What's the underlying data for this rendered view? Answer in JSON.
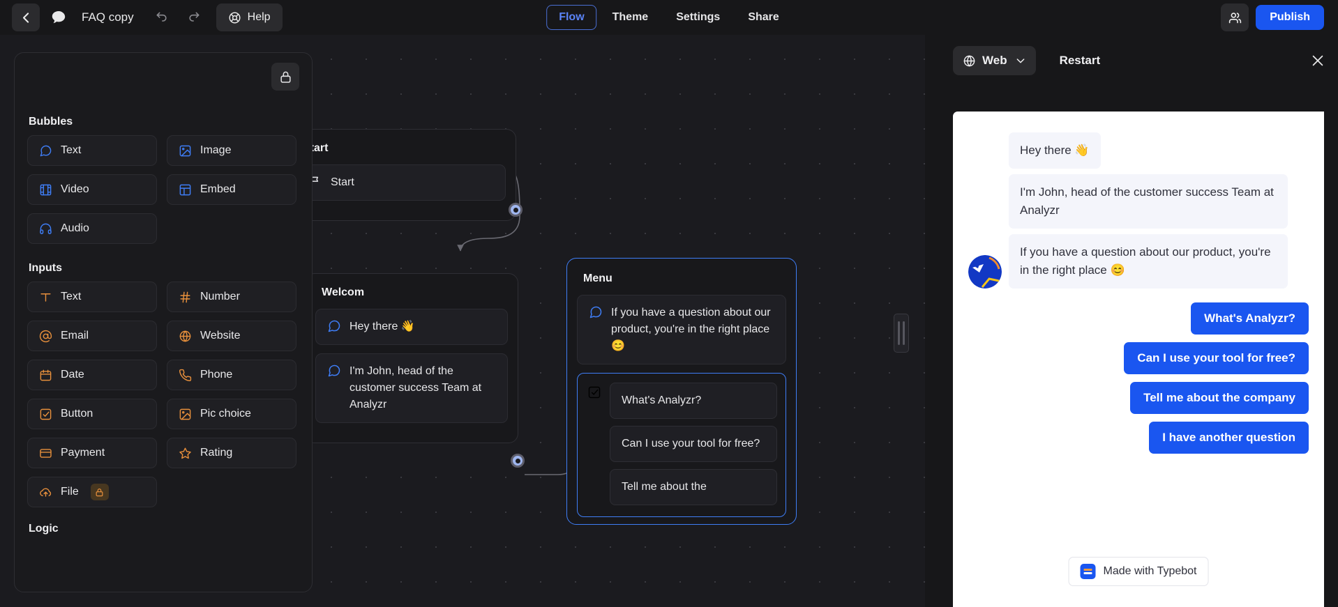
{
  "topbar": {
    "back_icon": "chevron-left-icon",
    "chat_icon": "speech-bubble-icon",
    "title": "FAQ copy",
    "undo_icon": "undo-icon",
    "redo_icon": "redo-icon",
    "help_label": "Help",
    "help_icon": "lifebuoy-icon",
    "tabs": [
      {
        "label": "Flow",
        "active": true
      },
      {
        "label": "Theme",
        "active": false
      },
      {
        "label": "Settings",
        "active": false
      },
      {
        "label": "Share",
        "active": false
      }
    ],
    "collaborators_icon": "users-icon",
    "publish_label": "Publish"
  },
  "blocks_panel": {
    "lock_icon": "lock-icon",
    "sections": [
      {
        "title": "Bubbles",
        "color": "#3f7ef7",
        "items": [
          {
            "label": "Text",
            "icon": "message-square-icon"
          },
          {
            "label": "Image",
            "icon": "image-icon"
          },
          {
            "label": "Video",
            "icon": "film-icon"
          },
          {
            "label": "Embed",
            "icon": "layout-icon"
          },
          {
            "label": "Audio",
            "icon": "headphones-icon"
          }
        ]
      },
      {
        "title": "Inputs",
        "color": "#e8903c",
        "items": [
          {
            "label": "Text",
            "icon": "type-icon"
          },
          {
            "label": "Number",
            "icon": "hash-icon"
          },
          {
            "label": "Email",
            "icon": "at-sign-icon"
          },
          {
            "label": "Website",
            "icon": "globe-icon"
          },
          {
            "label": "Date",
            "icon": "calendar-icon"
          },
          {
            "label": "Phone",
            "icon": "phone-icon"
          },
          {
            "label": "Button",
            "icon": "checkbox-icon"
          },
          {
            "label": "Pic choice",
            "icon": "image-icon"
          },
          {
            "label": "Payment",
            "icon": "credit-card-icon"
          },
          {
            "label": "Rating",
            "icon": "star-icon"
          },
          {
            "label": "File",
            "icon": "file-upload-icon",
            "locked": true
          }
        ]
      },
      {
        "title": "Logic",
        "color": "#9b6ef3",
        "items": []
      }
    ]
  },
  "canvas": {
    "groups": [
      {
        "title": "Start",
        "blocks": [
          {
            "type": "start",
            "icon": "flag-icon",
            "text": "Start"
          }
        ]
      },
      {
        "title": "Welcom",
        "blocks": [
          {
            "type": "text",
            "icon": "message-square-icon",
            "text": "Hey there 👋"
          },
          {
            "type": "text",
            "icon": "message-square-icon",
            "text": "I'm John, head of the customer success Team at Analyzr"
          }
        ]
      },
      {
        "title": "Menu",
        "blocks": [
          {
            "type": "text",
            "icon": "message-square-icon",
            "text": "If you have a question about our product, you're in the right place 😊"
          }
        ],
        "choice": {
          "icon": "checkbox-icon",
          "items": [
            "What's Analyzr?",
            "Can I use your tool for free?",
            "Tell me about the"
          ]
        }
      }
    ]
  },
  "preview": {
    "source_label": "Web",
    "source_icon": "globe-icon",
    "chevron_icon": "chevron-down-icon",
    "restart_label": "Restart",
    "close_icon": "close-icon",
    "avatar_name": "bot-avatar",
    "messages": [
      {
        "from": "bot",
        "text": "Hey there 👋"
      },
      {
        "from": "bot",
        "text": "I'm John, head of the customer success Team at Analyzr"
      },
      {
        "from": "bot",
        "text": "If you have a question about our product, you're in the right place 😊"
      }
    ],
    "answers": [
      "What's Analyzr?",
      "Can I use your tool for free?",
      "Tell me about the company",
      "I have another question"
    ],
    "badge": {
      "label": "Made with Typebot",
      "icon": "typebot-logo-icon"
    }
  },
  "colors": {
    "accent_blue": "#1a56f0",
    "node_blue": "#3f7ef7",
    "input_orange": "#e8903c",
    "panel_bg": "#1a1a1d",
    "canvas_bg": "#1b1b1f",
    "chat_bg": "#ffffff",
    "bubble_bg": "#f4f5fb"
  }
}
